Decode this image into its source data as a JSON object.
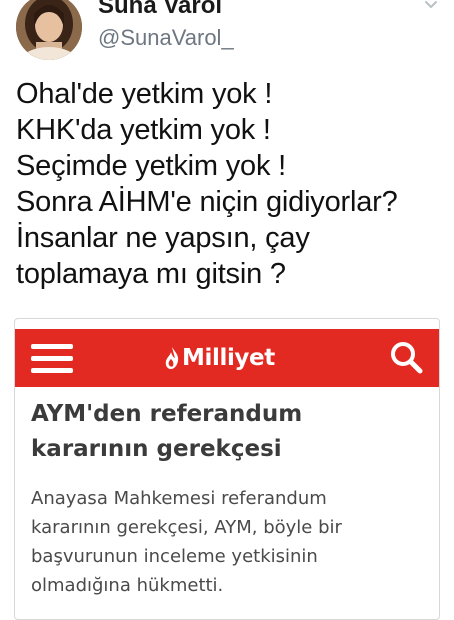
{
  "tweet": {
    "display_name": "Suna Varol",
    "handle": "@SunaVarol_",
    "lines": [
      "Ohal'de yetkim yok !",
      "KHK'da yetkim yok !",
      "Seçimde yetkim yok !",
      "Sonra AİHM'e niçin gidiyorlar?",
      "İnsanlar ne yapsın, çay",
      "toplamaya mı gitsin ?"
    ]
  },
  "card": {
    "brand": "Milliyet",
    "brand_color": "#e22a22",
    "headline_lines": [
      "AYM'den referandum",
      "kararının gerekçesi"
    ],
    "summary_lines": [
      "Anayasa Mahkemesi referandum",
      "kararının gerekçesi, AYM, böyle bir",
      "başvurunun inceleme yetkisinin",
      "olmadığına hükmetti."
    ]
  },
  "icons": {
    "avatar": "user-avatar",
    "chevron": "chevron-down-icon",
    "menu": "hamburger-menu-icon",
    "search": "search-icon",
    "brand_mark": "flame-icon"
  }
}
